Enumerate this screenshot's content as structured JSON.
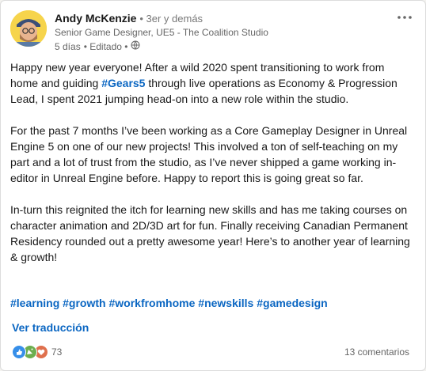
{
  "post": {
    "author": {
      "name": "Andy McKenzie",
      "degree": "• 3er y demás",
      "headline": "Senior Game Designer, UE5 - The Coalition Studio",
      "time": "5 días",
      "edited": "• Editado •",
      "visibility_icon": "globe-icon"
    },
    "more_icon": "ellipsis-icon",
    "paragraphs": [
      {
        "before": "Happy new year everyone! After a wild 2020 spent transitioning to work from home and guiding ",
        "hashtag": "#Gears5",
        "after": " through live operations as Economy & Progression Lead, I spent 2021 jumping head-on into a new role within the studio."
      },
      {
        "text": "For the past 7 months I’ve been working as a Core Gameplay Designer in Unreal Engine 5 on one of our new projects! This involved a ton of self-teaching on my part and a lot of trust from the studio, as I’ve never shipped a game working in-editor in Unreal Engine before. Happy to report this is going great so far."
      },
      {
        "text": "In-turn this reignited the itch for learning new skills and has me taking courses on character animation and 2D/3D art for fun. Finally receiving Canadian Permanent Residency rounded out a pretty awesome year! Here’s to another year of learning & growth!"
      }
    ],
    "hashtags": [
      "#learning",
      "#growth",
      "#workfromhome",
      "#newskills",
      "#gamedesign"
    ],
    "translate_label": "Ver traducción",
    "reactions": {
      "icons": [
        "like-icon",
        "celebrate-icon",
        "love-icon"
      ],
      "count": "73"
    },
    "comments_label": "13 comentarios"
  },
  "colors": {
    "link": "#0a66c2",
    "like": "#378fe9",
    "celebrate": "#6dae4f",
    "love": "#df704d"
  }
}
